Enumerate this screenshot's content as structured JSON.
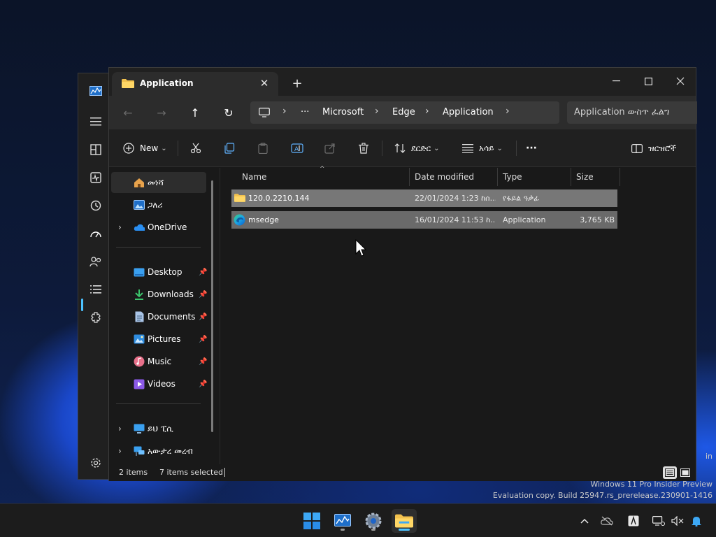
{
  "desktop": {
    "watermark_line1": "Windows 11 Pro Insider Preview",
    "watermark_line2": "Evaluation copy. Build 25947.rs_prerelease.230901-1416",
    "edge_text": "in"
  },
  "window": {
    "tab_title": "Application",
    "tab_close_glyph": "✕",
    "new_tab_glyph": "+",
    "minimize_glyph": "—",
    "close_glyph": "✕"
  },
  "nav": {
    "back_glyph": "←",
    "forward_glyph": "→",
    "up_glyph": "↑",
    "refresh_glyph": "↻",
    "breadcrumb_overflow": "···",
    "breadcrumb": [
      "Microsoft",
      "Edge",
      "Application"
    ],
    "breadcrumb_sep": "›",
    "search_placeholder": "Application ውስጥ ፈልግ"
  },
  "commands": {
    "new_label": "New",
    "sort_label": "ደርድር",
    "view_label": "አሳይ",
    "more_glyph": "···",
    "details_label": "ዝርዝሮች",
    "dropdown_glyph": "⌄"
  },
  "sidebar": {
    "expand_glyph": "›",
    "pin_glyph": "📌",
    "items": [
      {
        "label": "መነሻ",
        "icon": "home-icon"
      },
      {
        "label": "ጋለሪ",
        "icon": "gallery-icon"
      },
      {
        "label": "OneDrive",
        "icon": "onedrive-icon"
      },
      {
        "label": "Desktop",
        "icon": "desktop-icon"
      },
      {
        "label": "Downloads",
        "icon": "downloads-icon"
      },
      {
        "label": "Documents",
        "icon": "documents-icon"
      },
      {
        "label": "Pictures",
        "icon": "pictures-icon"
      },
      {
        "label": "Music",
        "icon": "music-icon"
      },
      {
        "label": "Videos",
        "icon": "videos-icon"
      },
      {
        "label": "ይህ ፒሲ",
        "icon": "this-pc-icon"
      },
      {
        "label": "አውታረ መረብ",
        "icon": "network-icon"
      }
    ]
  },
  "columns": {
    "name": "Name",
    "date": "Date modified",
    "type": "Type",
    "size": "Size",
    "sort_glyph": "^"
  },
  "files": [
    {
      "name": "120.0.2210.144",
      "date": "22/01/2024 1:23 ከሰ...",
      "type": "የፋይል ዓቃፊ",
      "size": "",
      "icon": "folder-icon"
    },
    {
      "name": "msedge",
      "date": "16/01/2024 11:53 ከ...",
      "type": "Application",
      "size": "3,765 KB",
      "icon": "edge-icon"
    }
  ],
  "status": {
    "item_count": "2 items",
    "selected_count": "7 items selected"
  },
  "colors": {
    "accent": "#4cc2ff",
    "window_bg": "#191919",
    "selection": "#777777"
  }
}
